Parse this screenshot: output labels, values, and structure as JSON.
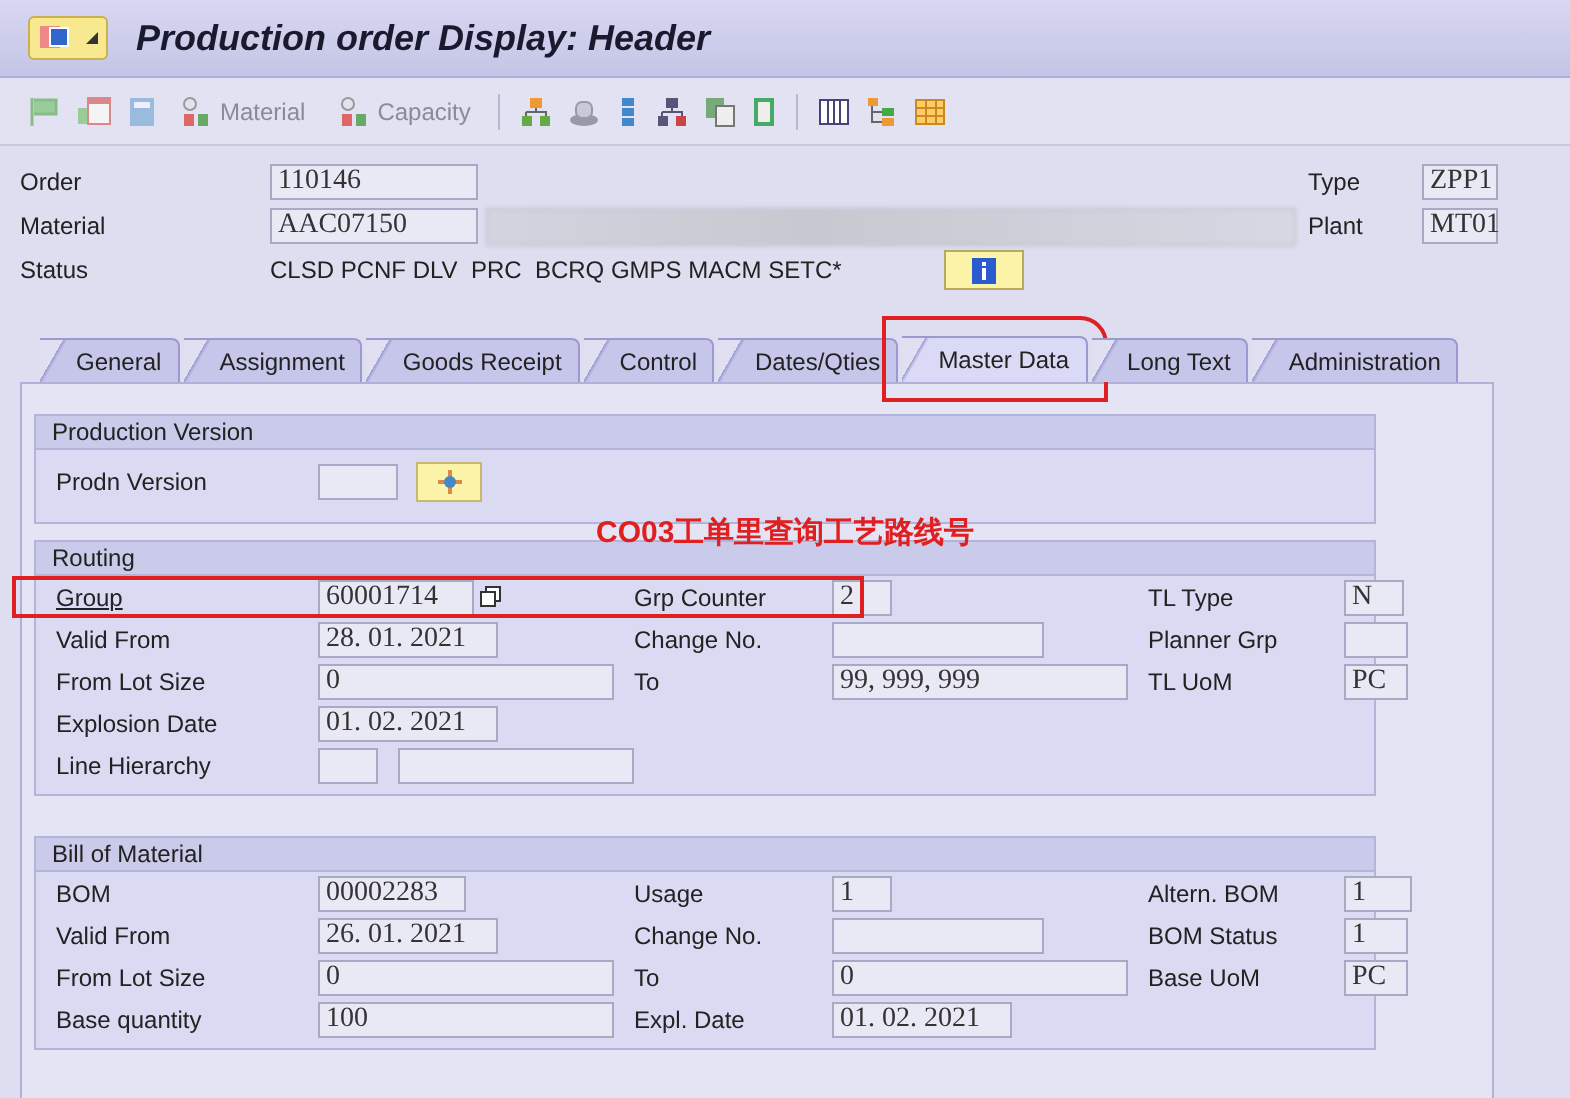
{
  "window": {
    "title": "Production order Display: Header"
  },
  "toolbar": {
    "buttons": [
      {
        "label": "Material",
        "disabled": true
      },
      {
        "label": "Capacity",
        "disabled": true
      }
    ]
  },
  "header": {
    "order": {
      "label": "Order",
      "value": "110146"
    },
    "material": {
      "label": "Material",
      "value": "AAC07150"
    },
    "status": {
      "label": "Status",
      "value": "CLSD PCNF DLV  PRC  BCRQ GMPS MACM SETC*"
    },
    "type": {
      "label": "Type",
      "value": "ZPP1"
    },
    "plant": {
      "label": "Plant",
      "value": "MT01"
    }
  },
  "tabs": [
    {
      "label": "General",
      "selected": false,
      "highlighted": false
    },
    {
      "label": "Assignment",
      "selected": false,
      "highlighted": false
    },
    {
      "label": "Goods Receipt",
      "selected": false,
      "highlighted": false
    },
    {
      "label": "Control",
      "selected": false,
      "highlighted": false
    },
    {
      "label": "Dates/Qties",
      "selected": false,
      "highlighted": false
    },
    {
      "label": "Master Data",
      "selected": true,
      "highlighted": true
    },
    {
      "label": "Long Text",
      "selected": false,
      "highlighted": false
    },
    {
      "label": "Administration",
      "selected": false,
      "highlighted": false
    }
  ],
  "sections": [
    {
      "title": "Production Version",
      "rows": [
        {
          "highlighted": false,
          "cells": [
            {
              "kind": "field_button",
              "label": "Prodn Version",
              "label_link": false
            }
          ]
        }
      ]
    },
    {
      "title": "Routing",
      "annotation": "CO03工单里查询工艺路线号",
      "rows": [
        {
          "highlighted": true,
          "cells": [
            {
              "kind": "field_copy",
              "label": "Group",
              "value": "60001714",
              "label_link": true
            },
            {
              "kind": "field",
              "label": "Grp Counter",
              "value": "2",
              "label_link": false
            },
            {
              "kind": "field",
              "label": "TL Type",
              "value": "N",
              "label_link": false
            }
          ]
        },
        {
          "highlighted": false,
          "cells": [
            {
              "kind": "field",
              "label": "Valid From",
              "value": "28. 01. 2021",
              "label_link": false
            },
            {
              "kind": "field",
              "label": "Change No.",
              "label_link": false
            },
            {
              "kind": "field",
              "label": "Planner Grp",
              "label_link": false
            }
          ]
        },
        {
          "highlighted": false,
          "cells": [
            {
              "kind": "field",
              "label": "From Lot Size",
              "value": "0",
              "label_link": false
            },
            {
              "kind": "field",
              "label": "To",
              "value": "99, 999, 999",
              "label_link": false
            },
            {
              "kind": "field",
              "label": "TL UoM",
              "value": "PC",
              "label_link": false
            }
          ]
        },
        {
          "highlighted": false,
          "cells": [
            {
              "kind": "field",
              "label": "Explosion Date",
              "value": "01. 02. 2021",
              "label_link": false
            }
          ]
        },
        {
          "highlighted": false,
          "cells": [
            {
              "kind": "double_field",
              "label": "Line Hierarchy",
              "label_link": false
            }
          ]
        }
      ]
    },
    {
      "title": "Bill of Material",
      "rows": [
        {
          "highlighted": false,
          "cells": [
            {
              "kind": "field",
              "label": "BOM",
              "value": "00002283",
              "label_link": false
            },
            {
              "kind": "field",
              "label": "Usage",
              "value": "1",
              "label_link": false
            },
            {
              "kind": "field",
              "label": "Altern. BOM",
              "value": "1",
              "label_link": false
            }
          ]
        },
        {
          "highlighted": false,
          "cells": [
            {
              "kind": "field",
              "label": "Valid From",
              "value": "26. 01. 2021",
              "label_link": false
            },
            {
              "kind": "field",
              "label": "Change No.",
              "label_link": false
            },
            {
              "kind": "field",
              "label": "BOM Status",
              "value": "1",
              "label_link": false
            }
          ]
        },
        {
          "highlighted": false,
          "cells": [
            {
              "kind": "field",
              "label": "From Lot Size",
              "value": "0",
              "label_link": false
            },
            {
              "kind": "field",
              "label": "To",
              "value": "0",
              "label_link": false
            },
            {
              "kind": "field",
              "label": "Base UoM",
              "value": "PC",
              "label_link": false
            }
          ]
        },
        {
          "highlighted": false,
          "cells": [
            {
              "kind": "field",
              "label": "Base quantity",
              "value": "100",
              "label_link": false
            },
            {
              "kind": "field",
              "label": "Expl. Date",
              "value": "01. 02. 2021",
              "label_link": false
            }
          ]
        }
      ]
    }
  ]
}
